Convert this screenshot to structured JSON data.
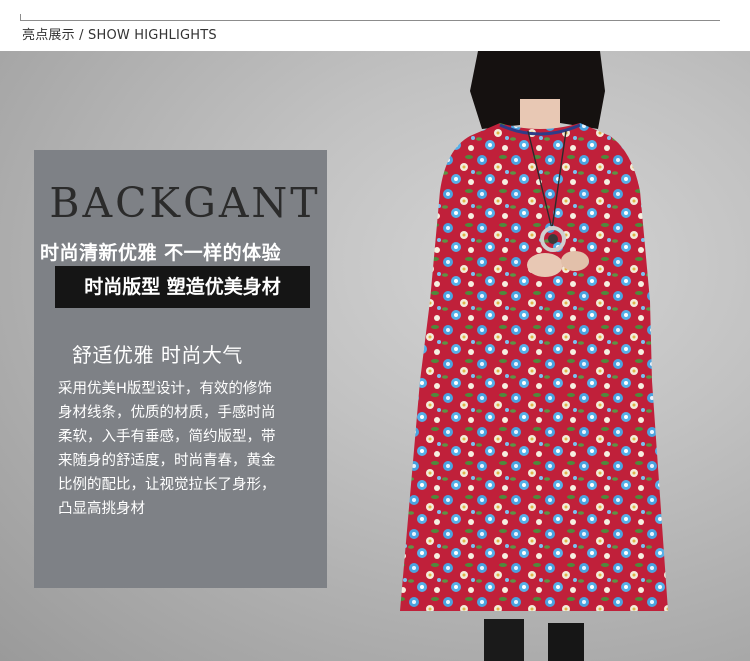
{
  "header": {
    "title": "亮点展示 / SHOW HIGHLIGHTS"
  },
  "panel": {
    "brand": "BACKGANT",
    "slogan": "时尚清新优雅 不一样的体验",
    "tag": "时尚版型 塑造优美身材",
    "subhead": "舒适优雅 时尚大气",
    "body_lines": [
      "采用优美H版型设计，有效的修饰",
      "身材线条，优质的材质，手感时尚",
      "柔软，入手有垂感，简约版型，带",
      "来随身的舒适度，时尚青春，黄金",
      "比例的配比，让视觉拉长了身形，",
      "凸显高挑身材"
    ]
  },
  "colors": {
    "panel": "#7e8186",
    "tag_background": "#151515",
    "dress_red": "#c0203a",
    "flower_blue": "#4aa3e0"
  }
}
